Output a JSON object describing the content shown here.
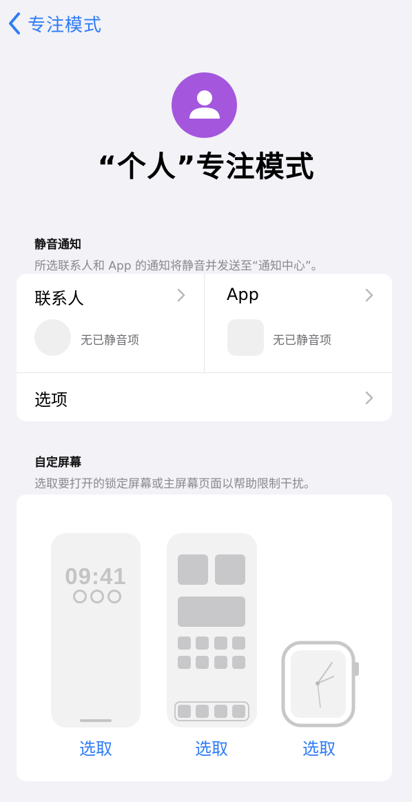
{
  "nav": {
    "back_label": "专注模式"
  },
  "header": {
    "title": "“个人”专注模式",
    "accent_color": "#a457dd"
  },
  "silence": {
    "title": "静音通知",
    "subtitle": "所选联系人和 App 的通知将静音并发送至“通知中心”。",
    "people": {
      "label": "联系人",
      "empty": "无已静音项"
    },
    "apps": {
      "label": "App",
      "empty": "无已静音项"
    },
    "options_label": "选项"
  },
  "screens": {
    "title": "自定屏幕",
    "subtitle": "选取要打开的锁定屏幕或主屏幕页面以帮助限制干扰。",
    "lock_time": "09:41",
    "choose_lock": "选取",
    "choose_home": "选取",
    "choose_watch": "选取"
  },
  "colors": {
    "link": "#2f7cf6",
    "background": "#f2f2f7"
  }
}
